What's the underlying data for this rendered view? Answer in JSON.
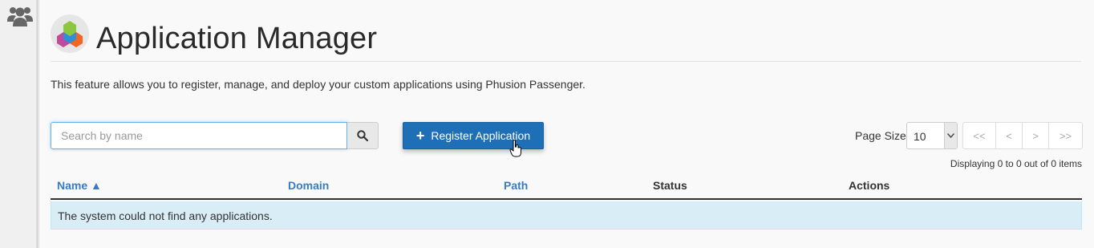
{
  "sidebar": {
    "icon": "users-icon"
  },
  "header": {
    "logo_icon": "cube-logo-icon",
    "title": "Application Manager"
  },
  "description": "This feature allows you to register, manage, and deploy your custom applications using Phusion Passenger.",
  "search": {
    "placeholder": "Search by name",
    "value": "",
    "button_icon": "search-icon"
  },
  "register_button": {
    "label": "Register Application",
    "icon": "plus-icon"
  },
  "pagination": {
    "page_size_label": "Page Size",
    "page_size": "10",
    "first": "<<",
    "prev": "<",
    "next": ">",
    "last": ">>",
    "summary": "Displaying 0 to 0 out of 0 items"
  },
  "table": {
    "columns": [
      {
        "label": "Name ▲",
        "sortable": true
      },
      {
        "label": "Domain",
        "sortable": true
      },
      {
        "label": "Path",
        "sortable": true
      },
      {
        "label": "Status",
        "sortable": false
      },
      {
        "label": "Actions",
        "sortable": false
      }
    ],
    "empty_message": "The system could not find any applications."
  },
  "colors": {
    "primary_button": "#1e6fb5",
    "link": "#3b7bbf",
    "empty_row_bg": "#d9edf7"
  }
}
